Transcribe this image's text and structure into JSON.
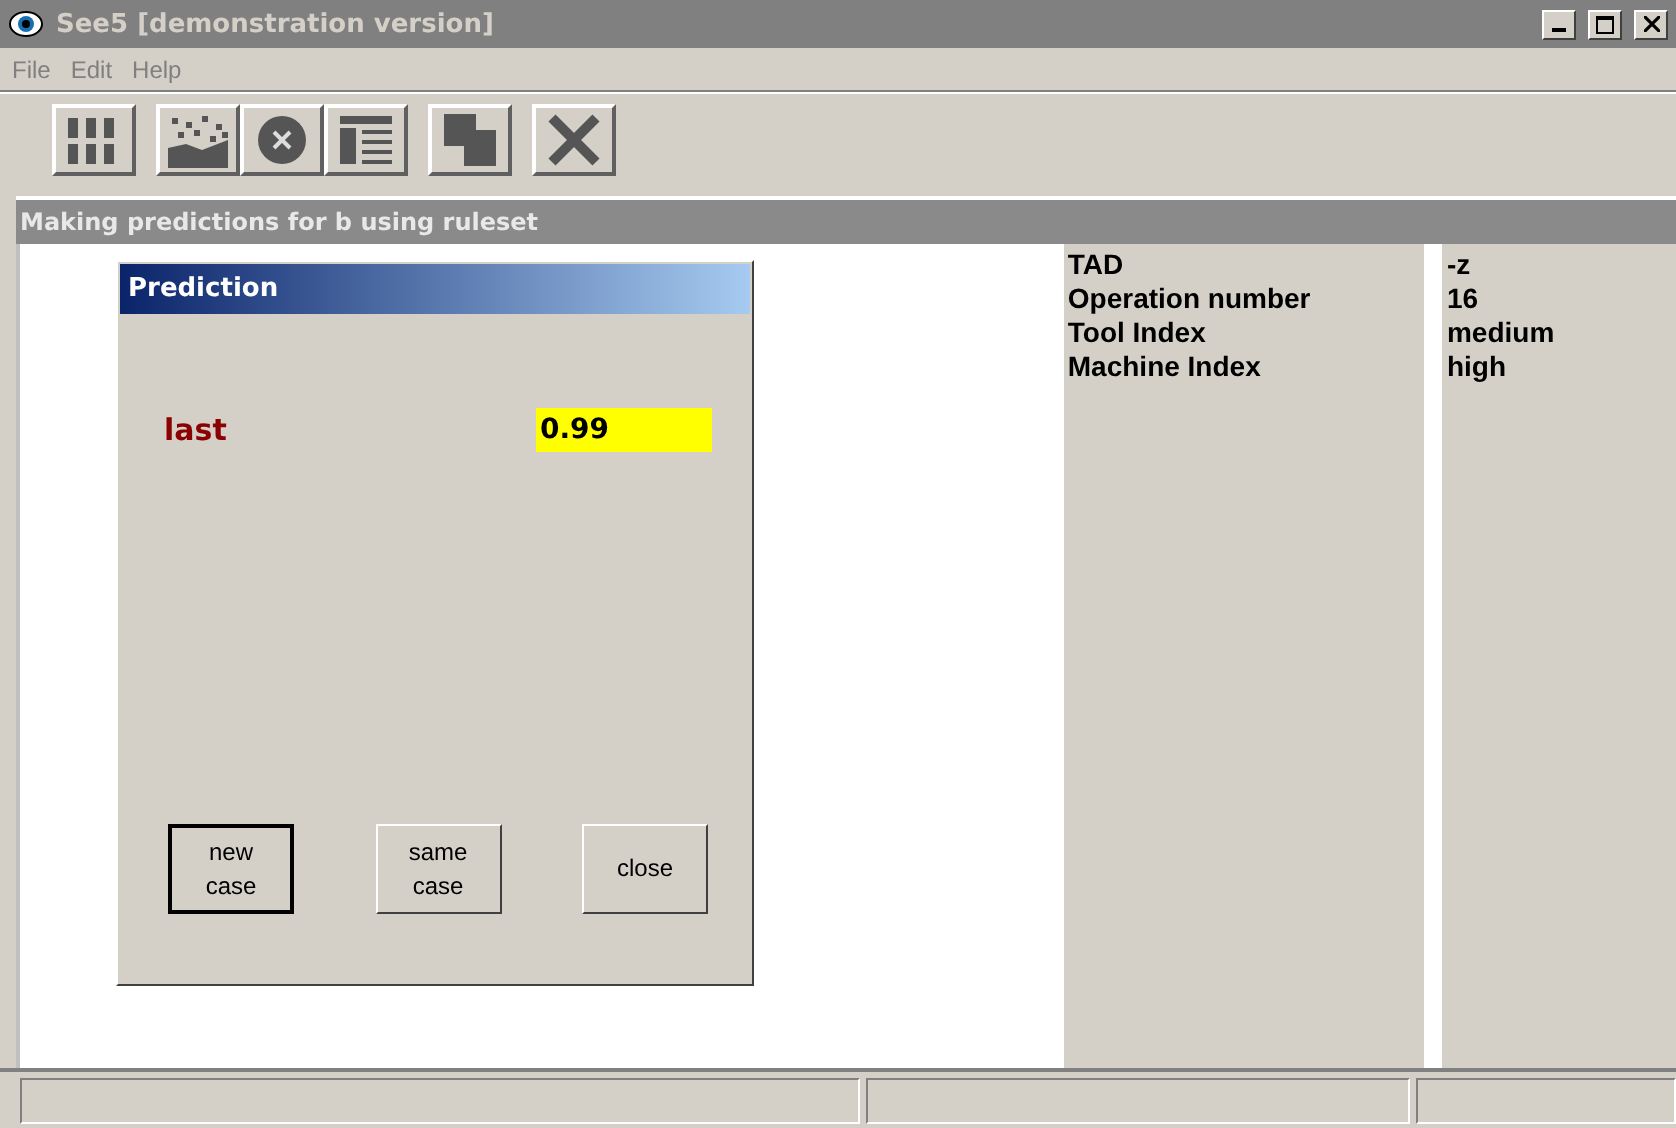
{
  "window": {
    "title": "See5 [demonstration version]",
    "active": false
  },
  "menu": [
    "File",
    "Edit",
    "Help"
  ],
  "toolbar": [
    {
      "kind": "digits"
    },
    {
      "kind": "scatter"
    },
    {
      "kind": "cancel"
    },
    {
      "kind": "list"
    },
    {
      "kind": "copy"
    },
    {
      "kind": "close"
    }
  ],
  "child_window": {
    "title": "Making predictions for b using ruleset"
  },
  "dialog": {
    "title": "Prediction",
    "label": "last",
    "value": "0.99",
    "buttons": [
      {
        "lines": [
          "new",
          "case"
        ],
        "default": true
      },
      {
        "lines": [
          "same",
          "case"
        ],
        "default": false
      },
      {
        "lines": [
          "close"
        ],
        "default": false
      }
    ]
  },
  "attributes": [
    {
      "name": "TAD",
      "value": "-z"
    },
    {
      "name": "Operation number",
      "value": "16"
    },
    {
      "name": "Tool Index",
      "value": "medium"
    },
    {
      "name": "Machine Index",
      "value": "high"
    }
  ]
}
